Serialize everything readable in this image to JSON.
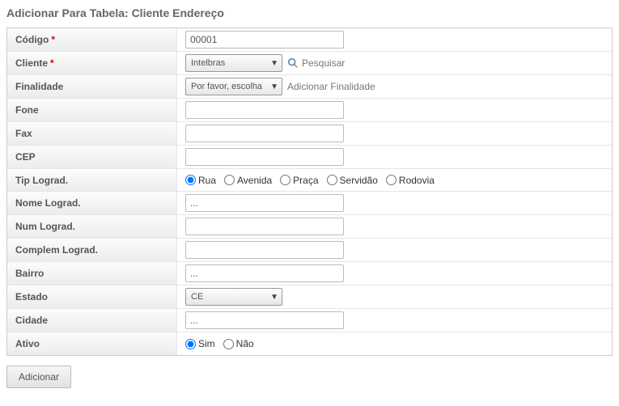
{
  "title": "Adicionar Para Tabela: Cliente Endereço",
  "labels": {
    "codigo": "Código",
    "cliente": "Cliente",
    "finalidade": "Finalidade",
    "fone": "Fone",
    "fax": "Fax",
    "cep": "CEP",
    "tipLograd": "Tip Lograd.",
    "nomeLograd": "Nome Lograd.",
    "numLograd": "Num Lograd.",
    "complemLograd": "Complem Lograd.",
    "bairro": "Bairro",
    "estado": "Estado",
    "cidade": "Cidade",
    "ativo": "Ativo"
  },
  "req": "*",
  "values": {
    "codigo": "00001",
    "cliente": "Intelbras",
    "finalidade": "Por favor, escolha",
    "fone": "",
    "fax": "",
    "cep": "",
    "nomeLograd": "...",
    "numLograd": "",
    "complemLograd": "",
    "bairro": "...",
    "estado": "CE",
    "cidade": "..."
  },
  "links": {
    "pesquisar": "Pesquisar",
    "adicionarFinalidade": "Adicionar Finalidade"
  },
  "tipLogradOptions": {
    "rua": "Rua",
    "avenida": "Avenida",
    "praca": "Praça",
    "servidao": "Servidão",
    "rodovia": "Rodovia"
  },
  "ativoOptions": {
    "sim": "Sim",
    "nao": "Não"
  },
  "buttons": {
    "adicionar": "Adicionar"
  }
}
